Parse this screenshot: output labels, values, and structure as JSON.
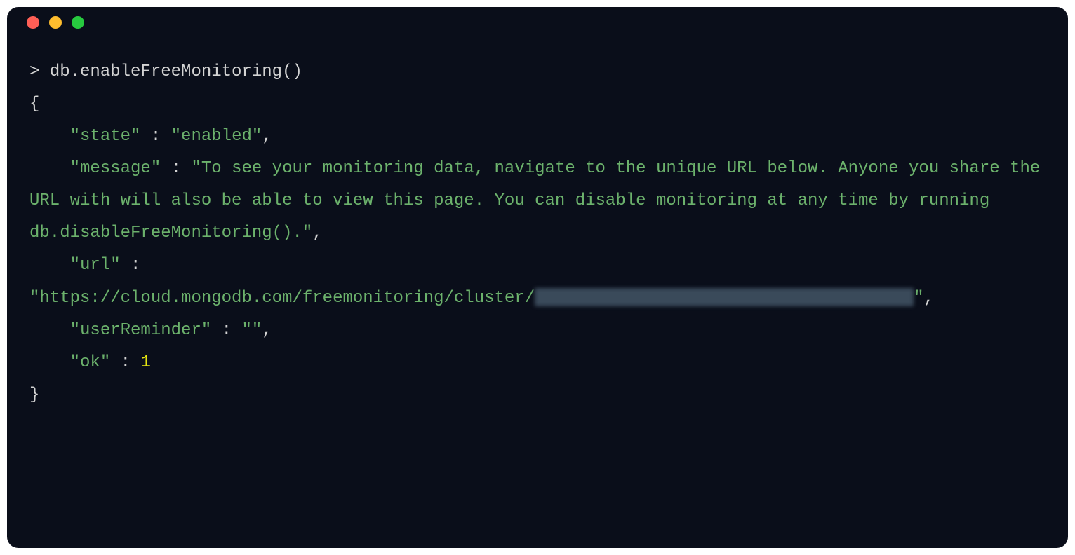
{
  "prompt": ">",
  "command": "db.enableFreeMonitoring()",
  "output": {
    "open_brace": "{",
    "close_brace": "}",
    "lines": {
      "state_key": "\"state\"",
      "state_value": "\"enabled\"",
      "message_key": "\"message\"",
      "message_value": "\"To see your monitoring data, navigate to the unique URL below. Anyone you share the URL with will also be able to view this page. You can disable monitoring at any time by running db.disableFreeMonitoring().\"",
      "url_key": "\"url\"",
      "url_value_prefix": "\"https://cloud.mongodb.com/freemonitoring/cluster/",
      "url_value_suffix": "\"",
      "userReminder_key": "\"userReminder\"",
      "userReminder_value": "\"\"",
      "ok_key": "\"ok\"",
      "ok_value": "1"
    },
    "colon": " : ",
    "comma": ","
  }
}
